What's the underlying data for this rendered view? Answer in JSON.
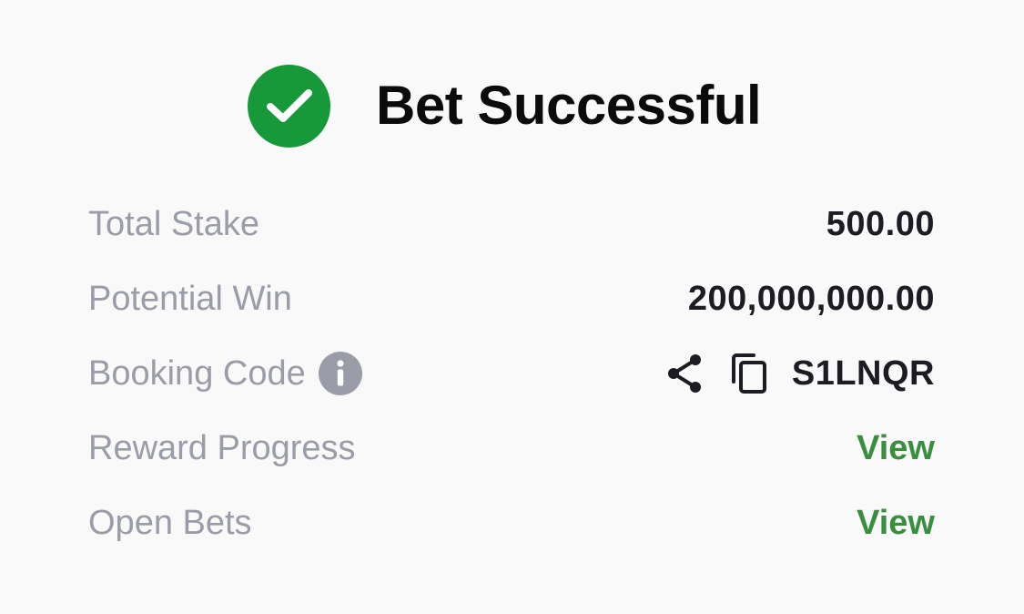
{
  "header": {
    "title": "Bet Successful",
    "status_icon": "check-circle-icon",
    "status_color": "#17993a"
  },
  "details": {
    "total_stake": {
      "label": "Total Stake",
      "value": "500.00"
    },
    "potential_win": {
      "label": "Potential Win",
      "value": "200,000,000.00"
    },
    "booking_code": {
      "label": "Booking Code",
      "info_icon": "info-icon",
      "share_icon": "share-icon",
      "copy_icon": "copy-icon",
      "value": "S1LNQR"
    },
    "reward_progress": {
      "label": "Reward Progress",
      "link": "View"
    },
    "open_bets": {
      "label": "Open Bets",
      "link": "View"
    }
  },
  "colors": {
    "label": "#9a9da8",
    "value": "#1c1c22",
    "link": "#3a8f3f"
  }
}
